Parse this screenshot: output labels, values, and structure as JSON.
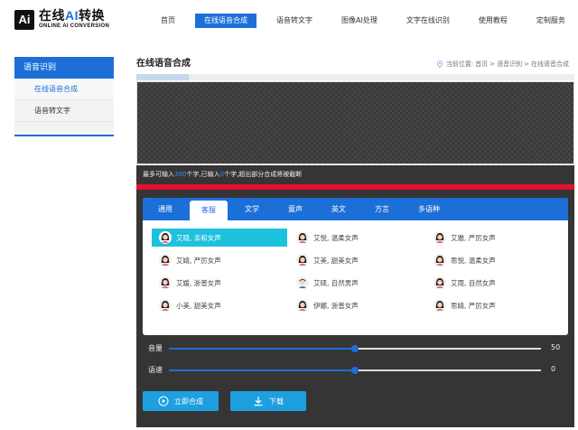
{
  "logo": {
    "box": "Ai",
    "title_a": "在线",
    "title_b": "AI",
    "title_c": "转换",
    "subtitle": "ONLINE AI CONVERSION"
  },
  "nav": [
    {
      "label": "首页"
    },
    {
      "label": "在线语音合成",
      "active": true
    },
    {
      "label": "语音转文字"
    },
    {
      "label": "图像AI处理"
    },
    {
      "label": "文字在线识别"
    },
    {
      "label": "使用教程"
    },
    {
      "label": "定制服务"
    }
  ],
  "sidebar": {
    "heading": "语音识别",
    "items": [
      {
        "label": "在线语音合成",
        "active": true
      },
      {
        "label": "语音转文字"
      }
    ]
  },
  "main": {
    "title": "在线语音合成",
    "breadcrumb": {
      "prefix": "当前位置:",
      "path": [
        "首页",
        ">",
        "语音识别",
        ">",
        "在线语音合成"
      ]
    }
  },
  "editor": {
    "value": "",
    "placeholder": ""
  },
  "hint": {
    "a": "最多可输入",
    "max": "300",
    "b": "个字,已输入",
    "count": "0",
    "c": "个字,超出部分合成将被截断"
  },
  "tabs": [
    "通用",
    "客服",
    "文学",
    "童声",
    "英文",
    "方言",
    "多语种"
  ],
  "active_tab": 1,
  "voices": [
    {
      "label": "艾晓, 亲和女声",
      "icon": "female-avatar-icon",
      "active": true
    },
    {
      "label": "艾悦, 温柔女声",
      "icon": "female-avatar-icon"
    },
    {
      "label": "艾雅, 严厉女声",
      "icon": "female-avatar-icon"
    },
    {
      "label": "艾婧, 严厉女声",
      "icon": "female-avatar-icon"
    },
    {
      "label": "艾美, 甜美女声",
      "icon": "female-avatar-icon"
    },
    {
      "label": "思悦, 温柔女声",
      "icon": "female-avatar-icon"
    },
    {
      "label": "艾媛, 浙普女声",
      "icon": "female-avatar-icon"
    },
    {
      "label": "艾硕, 自然男声",
      "icon": "male-avatar-icon"
    },
    {
      "label": "艾雨, 自然女声",
      "icon": "female-avatar-icon"
    },
    {
      "label": "小美, 甜美女声",
      "icon": "female-avatar-icon"
    },
    {
      "label": "伊娜, 浙普女声",
      "icon": "female-avatar-icon"
    },
    {
      "label": "思婧, 严厉女声",
      "icon": "female-avatar-icon"
    }
  ],
  "sliders": {
    "volume": {
      "label": "音量",
      "value": "50",
      "fraction": 0.5
    },
    "speed": {
      "label": "语速",
      "value": "0",
      "fraction": 0.5
    }
  },
  "buttons": {
    "synthesize": "立即合成",
    "download": "下载"
  },
  "colors": {
    "accent": "#1d6fd8",
    "active_voice": "#1ec1dd",
    "alert_bar": "#e5102d",
    "panel_bg": "#353535",
    "button": "#1e9fe0"
  }
}
